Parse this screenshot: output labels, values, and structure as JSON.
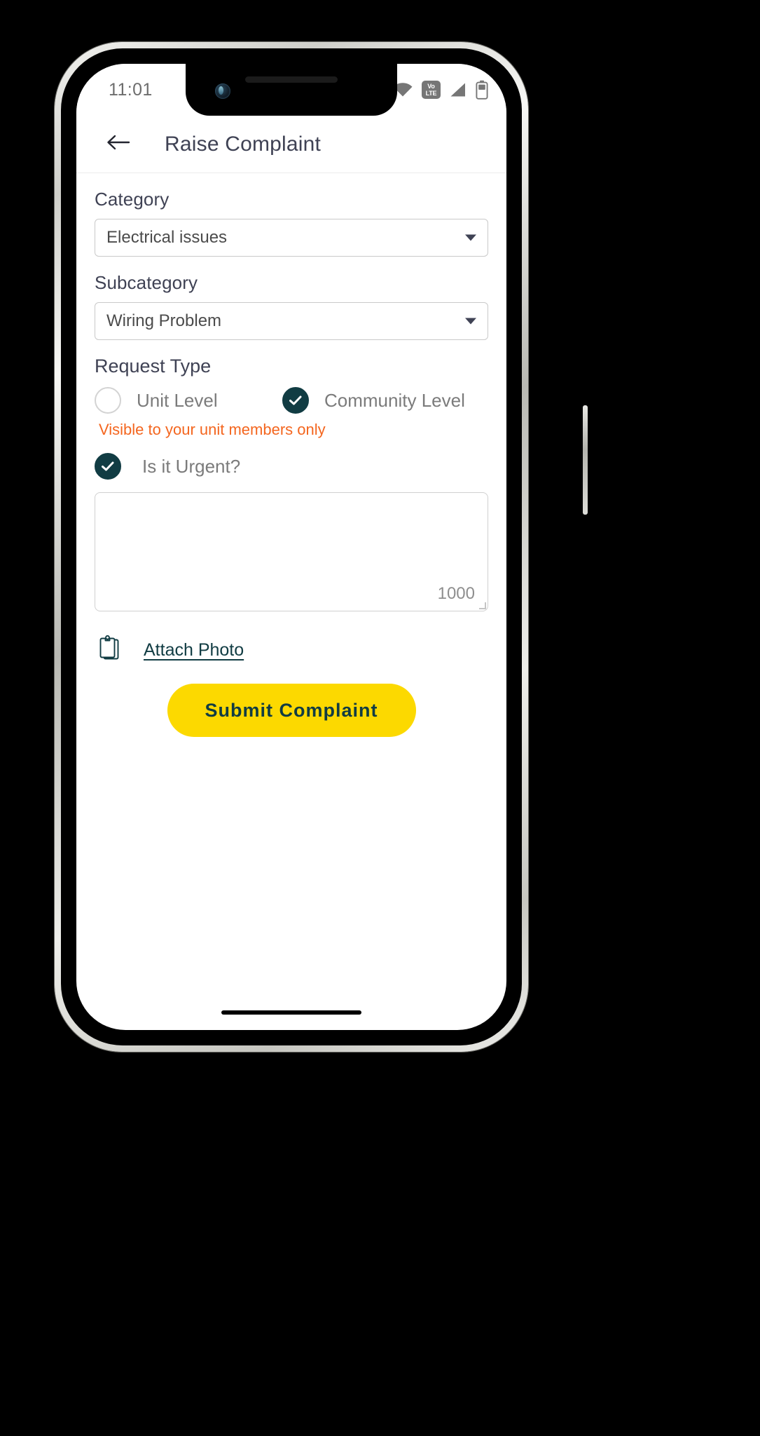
{
  "status_bar": {
    "time": "11:01",
    "icons": [
      {
        "name": "screen-record-icon",
        "label": "screen-record"
      },
      {
        "name": "wifi-icon",
        "label": "wifi"
      },
      {
        "name": "volte-icon",
        "line1": "Vo",
        "line2": "LTE"
      },
      {
        "name": "cellular-signal-icon",
        "label": "signal"
      },
      {
        "name": "battery-icon",
        "label": "battery"
      }
    ]
  },
  "app_bar": {
    "back_icon": "back-arrow-icon",
    "title": "Raise Complaint"
  },
  "form": {
    "category": {
      "label": "Category",
      "value": "Electrical issues",
      "caret_icon": "chevron-down-icon"
    },
    "subcategory": {
      "label": "Subcategory",
      "value": "Wiring Problem",
      "caret_icon": "chevron-down-icon"
    },
    "request_type": {
      "label": "Request Type",
      "options": [
        {
          "label": "Unit Level",
          "selected": false
        },
        {
          "label": "Community Level",
          "selected": true
        }
      ],
      "hint": "Visible to your unit members only"
    },
    "urgent": {
      "label": "Is it Urgent?",
      "checked": true
    },
    "description": {
      "value": "",
      "placeholder": "",
      "char_counter": "1000"
    },
    "attach": {
      "icon": "clipboard-icon",
      "label": "Attach Photo"
    },
    "submit": {
      "label": "Submit Complaint"
    }
  },
  "colors": {
    "accent_yellow": "#fcd900",
    "dark_teal": "#113c43",
    "hint_orange": "#f4661f",
    "title_slate": "#3f4254"
  }
}
